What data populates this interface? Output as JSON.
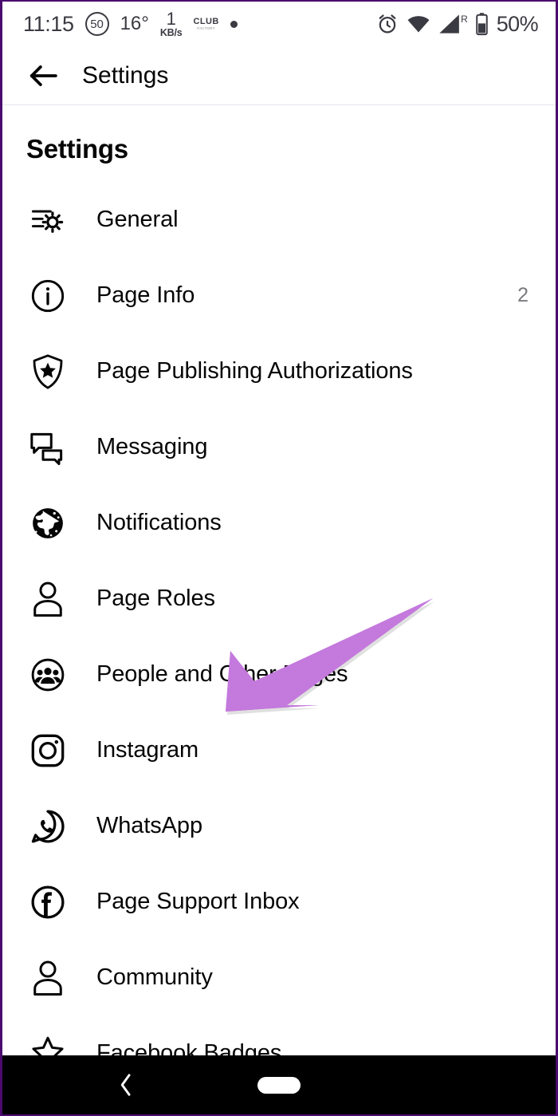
{
  "status_bar": {
    "time": "11:15",
    "circle_badge": "50",
    "temperature": "16°",
    "net_speed_value": "1",
    "net_speed_unit": "KB/s",
    "club_logo_main": "CLUB",
    "club_logo_sub": "FACTORY",
    "dot_indicator": "•",
    "alarm_icon": "alarm-clock-icon",
    "wifi_icon": "wifi-icon",
    "roaming_label": "R",
    "signal_icon": "cellular-signal-icon",
    "battery_icon": "battery-icon",
    "battery_percent": "50%"
  },
  "appbar": {
    "back_icon": "back-arrow-icon",
    "title": "Settings"
  },
  "page": {
    "section_title": "Settings"
  },
  "settings_items": [
    {
      "label": "General",
      "icon": "sliders-gear-icon",
      "badge": ""
    },
    {
      "label": "Page Info",
      "icon": "info-circle-icon",
      "badge": "2"
    },
    {
      "label": "Page Publishing Authorizations",
      "icon": "shield-star-icon",
      "badge": ""
    },
    {
      "label": "Messaging",
      "icon": "chat-bubbles-icon",
      "badge": ""
    },
    {
      "label": "Notifications",
      "icon": "globe-icon",
      "badge": ""
    },
    {
      "label": "Page Roles",
      "icon": "person-icon",
      "badge": ""
    },
    {
      "label": "People and Other Pages",
      "icon": "people-group-circle-icon",
      "badge": ""
    },
    {
      "label": "Instagram",
      "icon": "instagram-icon",
      "badge": ""
    },
    {
      "label": "WhatsApp",
      "icon": "whatsapp-icon",
      "badge": ""
    },
    {
      "label": "Page Support Inbox",
      "icon": "facebook-circle-icon",
      "badge": ""
    },
    {
      "label": "Community",
      "icon": "person-icon",
      "badge": ""
    },
    {
      "label": "Facebook Badges",
      "icon": "badge-star-icon",
      "badge": ""
    }
  ],
  "annotation": {
    "arrow_color": "#c479dd",
    "arrow_target": "Page Roles"
  },
  "nav_bar": {
    "back_icon": "nav-back-chevron-icon",
    "home_indicator": "home-pill-indicator"
  }
}
